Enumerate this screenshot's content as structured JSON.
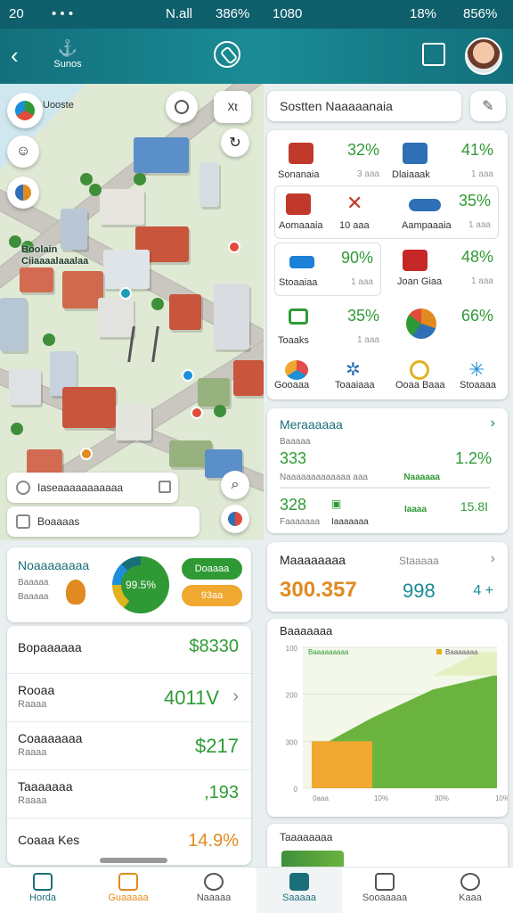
{
  "status_bar": {
    "left_time": "20",
    "left_dots": "• • •",
    "mid_signal": "N.all",
    "mid_battery": "386%",
    "center_time": "1080",
    "right_pct": "18%",
    "right_battery": "856%"
  },
  "header": {
    "logo_label": "Sunos",
    "back_icon": "chevron-left-icon",
    "center_icon": "compass-icon",
    "book_icon": "book-icon"
  },
  "map": {
    "top_pill": "Uooste",
    "right_pill": "Xt",
    "area_label": "Boolain\nCiiaaaalaaalaa",
    "search_one": "Iaseaaaaaaaaaaa",
    "search_two": "Boaaaas"
  },
  "search": {
    "placeholder": "Sostten Naaaaanaia"
  },
  "stats": [
    {
      "label": "Sonanaia",
      "pct": "32%",
      "sub": "3 aaa",
      "color": "#c0392b"
    },
    {
      "label": "Dlaiaaak",
      "pct": "41%",
      "sub": "1 aaa",
      "color": "#2e6fb5"
    },
    {
      "label": "Aomaaaia",
      "pct": "",
      "sub": "",
      "color": "#c0392b"
    },
    {
      "label": "10 aaa",
      "pct": "",
      "sub": "",
      "color": "#2e6fb5"
    },
    {
      "label": "Aampaaaia",
      "pct": "35%",
      "sub": "1 aaa",
      "color": "#2e6fb5"
    },
    {
      "label": "Stoaaiaa",
      "pct": "90%",
      "sub": "1 aaa",
      "color": "#1c7fd8"
    },
    {
      "label": "Joan Giaa",
      "pct": "48%",
      "sub": "1 aaa",
      "color": "#c62828"
    },
    {
      "label": "Toaaks",
      "pct": "35%",
      "sub": "1 aaa",
      "color": "#2f9a35"
    },
    {
      "label": "",
      "pct": "66%",
      "sub": "",
      "color": "#e08a1f"
    },
    {
      "label": "Gooaaa",
      "pct": "",
      "sub": "",
      "color": "#e14c4c"
    },
    {
      "label": "Toaaiaaa",
      "pct": "",
      "sub": "",
      "color": "#2e6fb5"
    },
    {
      "label": "Ooaa Baaa",
      "pct": "",
      "sub": "",
      "color": "#e0b21f"
    },
    {
      "label": "Stoaaaa",
      "pct": "",
      "sub": "",
      "color": "#1c8fd8"
    }
  ],
  "overview": {
    "title": "Meraaaaaa",
    "row1_label": "Baaaaa",
    "row1_val1": "333",
    "row1_val2": "1.2%",
    "row2_label": "Naaaaaaaaaaaaa aaa",
    "row2_tag": "Naaaaaa",
    "row3_val1": "328",
    "row3_val2": "15.8I",
    "row3_sub": "Faaaaaaa",
    "row3_sub2": "Iaaaaaaa",
    "row3_tag": "Iaaaa"
  },
  "metrics": {
    "title": "Maaaaaaaa",
    "link": "Staaaaa",
    "big_value": "300.357",
    "mid_value": "998",
    "right_value": "4 +"
  },
  "chart_card": {
    "title": "Baaaaaaa",
    "legend_1": "Baaaaaaaaa",
    "legend_2": "Baaaaaaa"
  },
  "chart_data": {
    "type": "area",
    "title": "",
    "xlabel": "",
    "ylabel": "",
    "ytick_labels": [
      "100",
      "200",
      "300",
      "0"
    ],
    "xtick_labels": [
      "0aaa",
      "10%",
      "30%",
      "10%"
    ],
    "series": [
      {
        "name": "Baaaaaaaaa",
        "color": "#f0a830",
        "x": [
          0,
          1
        ],
        "y": [
          100,
          100
        ]
      },
      {
        "name": "Baaaaaaa",
        "color": "#6bb33f",
        "x": [
          0,
          1,
          2,
          3
        ],
        "y": [
          80,
          150,
          210,
          240
        ]
      }
    ]
  },
  "bottom_card": {
    "title": "Taaaaaaaa"
  },
  "budget": {
    "title": "Noaaaaaaaa",
    "sub1": "Baaaaa",
    "sub2": "Baaaaa",
    "donut_value": "99.5%",
    "btn_primary": "Doaaaa",
    "btn_secondary": "93aa"
  },
  "list_rows": [
    {
      "name": "Bopaaaaaa",
      "sub": "",
      "value": "$8330"
    },
    {
      "name": "Rooaa",
      "sub": "Raaaa",
      "value": "4011V"
    },
    {
      "name": "Coaaaaaaa",
      "sub": "Raaaa",
      "value": "$217"
    },
    {
      "name": "Taaaaaaa",
      "sub": "Raaaa",
      "value": ",193"
    },
    {
      "name": "Coaaa Kes",
      "sub": "",
      "value": "14.9%"
    }
  ],
  "nav": [
    {
      "label": "Horda",
      "icon": "map-icon"
    },
    {
      "label": "Guaaaaa",
      "icon": "home-icon"
    },
    {
      "label": "Naaaaa",
      "icon": "people-icon"
    },
    {
      "label": "Saaaaa",
      "icon": "home-icon"
    },
    {
      "label": "Sooaaaaa",
      "icon": "chat-icon"
    },
    {
      "label": "Kaaa",
      "icon": "alert-icon"
    }
  ]
}
